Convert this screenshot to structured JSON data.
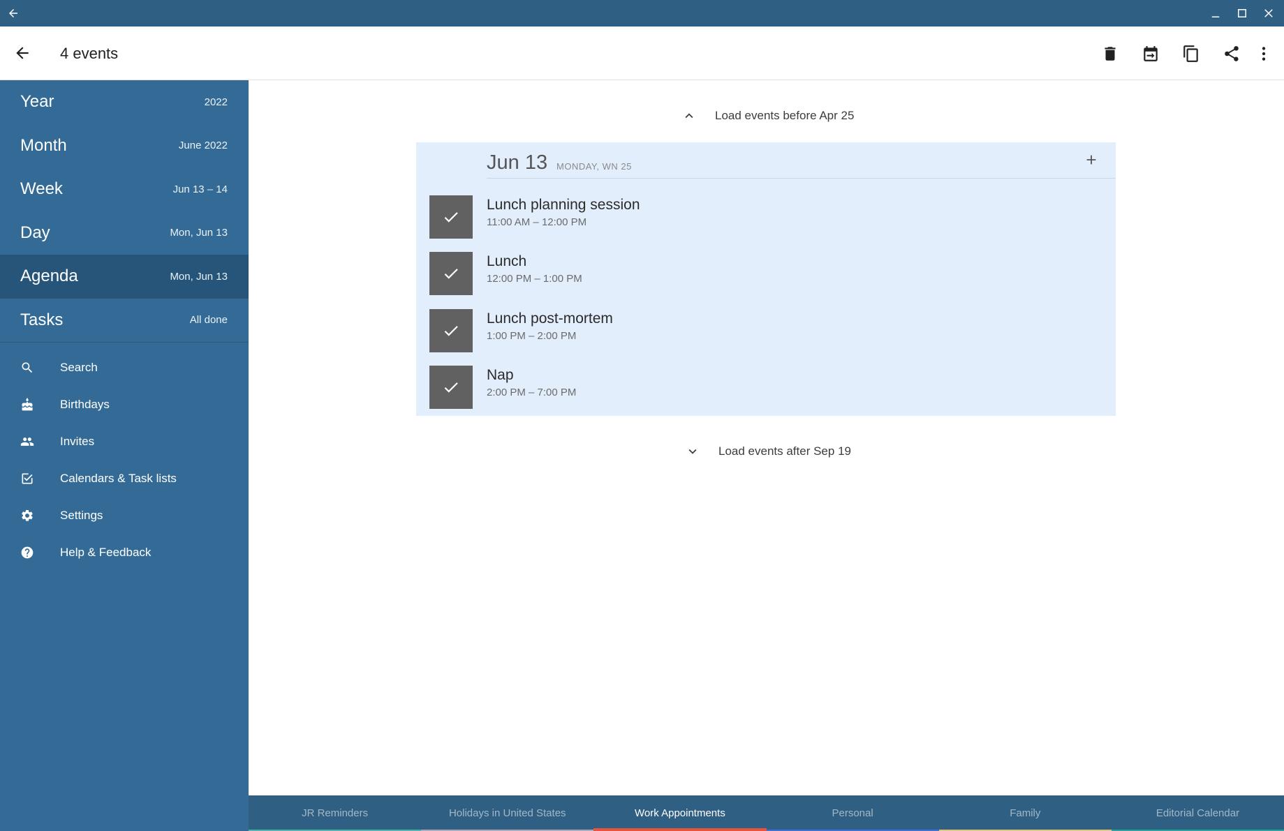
{
  "window": {
    "back_icon": "arrow-left-icon",
    "minimize_icon": "minimize-icon",
    "maximize_icon": "maximize-icon",
    "close_icon": "close-icon"
  },
  "appbar": {
    "title": "4 events",
    "actions": [
      "delete-icon",
      "move-to-date-icon",
      "copy-icon",
      "share-icon",
      "more-vert-icon"
    ]
  },
  "sidebar": {
    "views": [
      {
        "label": "Year",
        "sub": "2022",
        "active": false
      },
      {
        "label": "Month",
        "sub": "June 2022",
        "active": false
      },
      {
        "label": "Week",
        "sub": "Jun 13 – 14",
        "active": false
      },
      {
        "label": "Day",
        "sub": "Mon, Jun 13",
        "active": false
      },
      {
        "label": "Agenda",
        "sub": "Mon, Jun 13",
        "active": true
      },
      {
        "label": "Tasks",
        "sub": "All done",
        "active": false
      }
    ],
    "nav": [
      {
        "label": "Search",
        "icon": "search-icon"
      },
      {
        "label": "Birthdays",
        "icon": "cake-icon"
      },
      {
        "label": "Invites",
        "icon": "people-icon"
      },
      {
        "label": "Calendars & Task lists",
        "icon": "checklist-icon"
      },
      {
        "label": "Settings",
        "icon": "gear-icon"
      },
      {
        "label": "Help & Feedback",
        "icon": "help-icon"
      }
    ]
  },
  "agenda": {
    "load_before": "Load events before Apr 25",
    "load_after": "Load events after Sep 19",
    "day": {
      "date": "Jun 13",
      "meta": "MONDAY,  WN 25",
      "events": [
        {
          "title": "Lunch planning session",
          "time": "11:00 AM – 12:00 PM",
          "done": true
        },
        {
          "title": "Lunch",
          "time": "12:00 PM – 1:00 PM",
          "done": true
        },
        {
          "title": "Lunch post-mortem",
          "time": "1:00 PM – 2:00 PM",
          "done": true
        },
        {
          "title": "Nap",
          "time": "2:00 PM – 7:00 PM",
          "done": true
        }
      ]
    }
  },
  "calendar_tabs": [
    {
      "label": "JR Reminders",
      "color": "#4db6ac",
      "active": false
    },
    {
      "label": "Holidays in United States",
      "color": "#b0a8b9",
      "active": false
    },
    {
      "label": "Work Appointments",
      "color": "#e8533f",
      "active": true
    },
    {
      "label": "Personal",
      "color": "#3f6fd8",
      "active": false
    },
    {
      "label": "Family",
      "color": "#e6c27a",
      "active": false
    },
    {
      "label": "Editorial Calendar",
      "color": "#26a69a",
      "active": false
    }
  ],
  "colors": {
    "primary": "#346b96",
    "primary_dark": "#265579",
    "titlebar": "#2f5f82",
    "day_card": "#e3eefc",
    "check_box": "#616161"
  }
}
